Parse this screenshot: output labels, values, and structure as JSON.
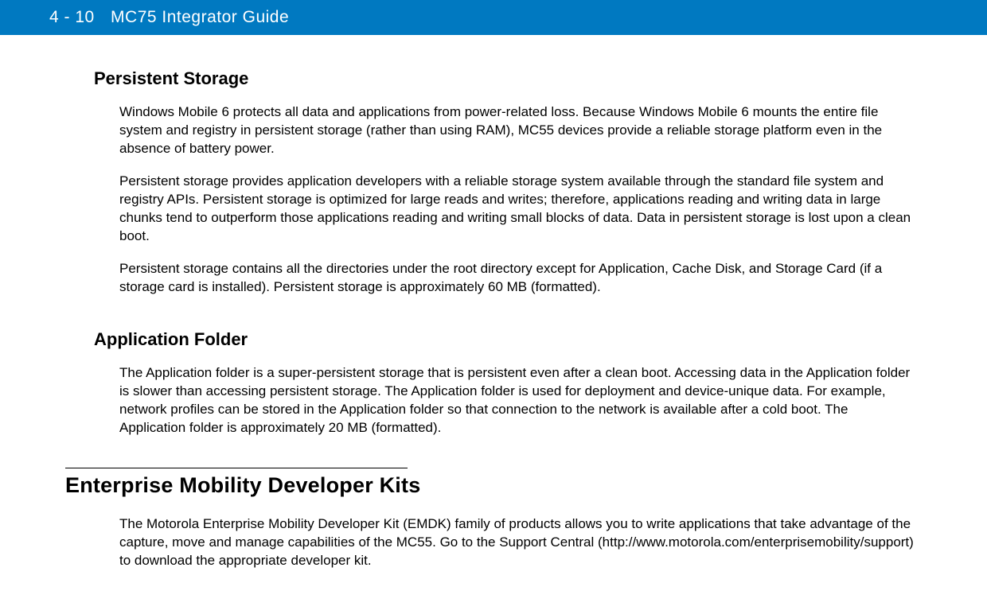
{
  "header": {
    "pageNumber": "4 - 10",
    "title": "MC75 Integrator Guide"
  },
  "sections": [
    {
      "heading": "Persistent Storage",
      "level": "h2",
      "paragraphs": [
        "Windows Mobile 6 protects all data and applications from power-related loss. Because Windows Mobile 6 mounts the entire file system and registry in persistent storage (rather than using RAM), MC55 devices provide a reliable storage platform even in the absence of battery power.",
        "Persistent storage provides application developers with a reliable storage system available through the standard file system and registry APIs. Persistent storage is optimized for large reads and writes; therefore, applications reading and writing data in large chunks tend to outperform those applications reading and writing small blocks of data. Data in persistent storage is lost upon a clean boot.",
        "Persistent storage contains all the directories under the root directory except for Application, Cache Disk, and Storage Card (if a storage card is installed). Persistent storage is approximately 60 MB (formatted)."
      ]
    },
    {
      "heading": "Application Folder",
      "level": "h2",
      "paragraphs": [
        "The Application folder is a super-persistent storage that is persistent even after a clean boot. Accessing data in the Application folder is slower than accessing persistent storage. The Application folder is used for deployment and device-unique data. For example, network profiles can be stored in the Application folder so that connection to the network is available after a cold boot. The Application folder is approximately 20 MB (formatted)."
      ]
    },
    {
      "heading": "Enterprise Mobility Developer Kits",
      "level": "h1",
      "divider": true,
      "paragraphs": [
        "The Motorola Enterprise Mobility Developer Kit (EMDK) family of products allows you to write applications that take advantage of the capture, move and manage capabilities of the MC55. Go to the Support Central (http://www.motorola.com/enterprisemobility/support) to download the appropriate developer kit."
      ]
    }
  ]
}
